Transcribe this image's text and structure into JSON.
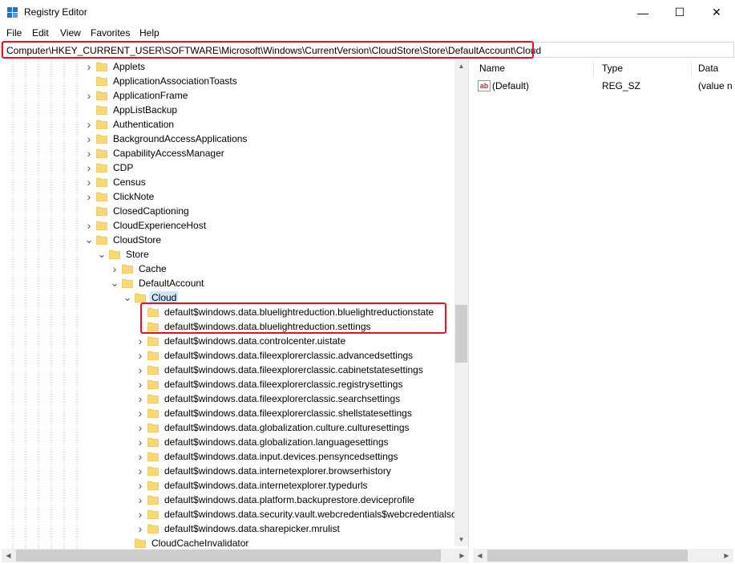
{
  "window": {
    "title": "Registry Editor",
    "minimize": "—",
    "maximize": "☐",
    "close": "✕"
  },
  "menu": [
    {
      "label": "File"
    },
    {
      "label": "Edit"
    },
    {
      "label": "View"
    },
    {
      "label": "Favorites"
    },
    {
      "label": "Help"
    }
  ],
  "address": {
    "path": "Computer\\HKEY_CURRENT_USER\\SOFTWARE\\Microsoft\\Windows\\CurrentVersion\\CloudStore\\Store\\DefaultAccount\\Cloud"
  },
  "tree": [
    {
      "label": "Applets",
      "level": 0,
      "chevron": "right"
    },
    {
      "label": "ApplicationAssociationToasts",
      "level": 0,
      "chevron": "none"
    },
    {
      "label": "ApplicationFrame",
      "level": 0,
      "chevron": "right"
    },
    {
      "label": "AppListBackup",
      "level": 0,
      "chevron": "none"
    },
    {
      "label": "Authentication",
      "level": 0,
      "chevron": "right"
    },
    {
      "label": "BackgroundAccessApplications",
      "level": 0,
      "chevron": "right"
    },
    {
      "label": "CapabilityAccessManager",
      "level": 0,
      "chevron": "right"
    },
    {
      "label": "CDP",
      "level": 0,
      "chevron": "right"
    },
    {
      "label": "Census",
      "level": 0,
      "chevron": "right"
    },
    {
      "label": "ClickNote",
      "level": 0,
      "chevron": "right"
    },
    {
      "label": "ClosedCaptioning",
      "level": 0,
      "chevron": "none"
    },
    {
      "label": "CloudExperienceHost",
      "level": 0,
      "chevron": "right"
    },
    {
      "label": "CloudStore",
      "level": 0,
      "chevron": "down"
    },
    {
      "label": "Store",
      "level": 1,
      "chevron": "down"
    },
    {
      "label": "Cache",
      "level": 2,
      "chevron": "right"
    },
    {
      "label": "DefaultAccount",
      "level": 2,
      "chevron": "down"
    },
    {
      "label": "Cloud",
      "level": 3,
      "chevron": "down",
      "selected": true
    },
    {
      "label": "default$windows.data.bluelightreduction.bluelightreductionstate",
      "level": 4,
      "chevron": "none"
    },
    {
      "label": "default$windows.data.bluelightreduction.settings",
      "level": 4,
      "chevron": "none"
    },
    {
      "label": "default$windows.data.controlcenter.uistate",
      "level": 4,
      "chevron": "right"
    },
    {
      "label": "default$windows.data.fileexplorerclassic.advancedsettings",
      "level": 4,
      "chevron": "right"
    },
    {
      "label": "default$windows.data.fileexplorerclassic.cabinetstatesettings",
      "level": 4,
      "chevron": "right"
    },
    {
      "label": "default$windows.data.fileexplorerclassic.registrysettings",
      "level": 4,
      "chevron": "right"
    },
    {
      "label": "default$windows.data.fileexplorerclassic.searchsettings",
      "level": 4,
      "chevron": "right"
    },
    {
      "label": "default$windows.data.fileexplorerclassic.shellstatesettings",
      "level": 4,
      "chevron": "right"
    },
    {
      "label": "default$windows.data.globalization.culture.culturesettings",
      "level": 4,
      "chevron": "right"
    },
    {
      "label": "default$windows.data.globalization.languagesettings",
      "level": 4,
      "chevron": "right"
    },
    {
      "label": "default$windows.data.input.devices.pensyncedsettings",
      "level": 4,
      "chevron": "right"
    },
    {
      "label": "default$windows.data.internetexplorer.browserhistory",
      "level": 4,
      "chevron": "right"
    },
    {
      "label": "default$windows.data.internetexplorer.typedurls",
      "level": 4,
      "chevron": "right"
    },
    {
      "label": "default$windows.data.platform.backuprestore.deviceprofile",
      "level": 4,
      "chevron": "right"
    },
    {
      "label": "default$windows.data.security.vault.webcredentials$webcredentialscl",
      "level": 4,
      "chevron": "right"
    },
    {
      "label": "default$windows.data.sharepicker.mrulist",
      "level": 4,
      "chevron": "right"
    },
    {
      "label": "CloudCacheInvalidator",
      "level": 3,
      "chevron": "none"
    }
  ],
  "values": {
    "headers": {
      "name": "Name",
      "type": "Type",
      "data": "Data"
    },
    "rows": [
      {
        "name": "(Default)",
        "type": "REG_SZ",
        "data": "(value n",
        "icon": "ab-string-icon"
      }
    ]
  },
  "colors": {
    "highlight": "#e81123",
    "selection": "#cce8ff",
    "folder": "#f8d775"
  }
}
